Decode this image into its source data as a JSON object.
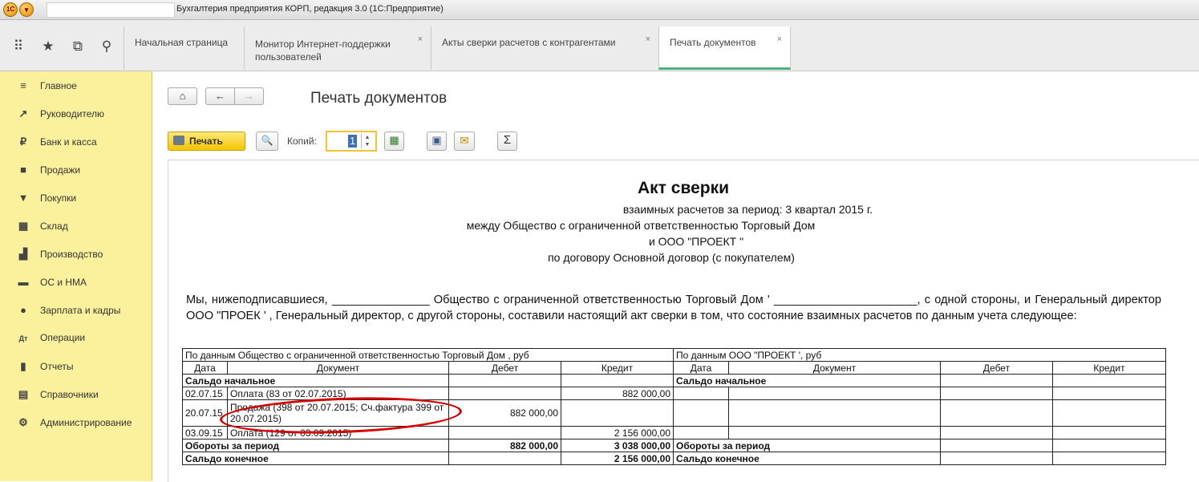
{
  "window": {
    "title": "Бухгалтерия предприятия КОРП, редакция 3.0  (1С:Предприятие)",
    "sys_icon": "1С"
  },
  "tabs": [
    {
      "label": "Начальная страница",
      "closable": false
    },
    {
      "label": "Монитор Интернет-поддержки пользователей",
      "closable": true
    },
    {
      "label": "Акты сверки расчетов с контрагентами",
      "closable": true
    },
    {
      "label": "Печать документов",
      "closable": true,
      "active": true
    }
  ],
  "close_glyph": "×",
  "sidebar": {
    "items": [
      {
        "label": "Главное",
        "icon": "≡"
      },
      {
        "label": "Руководителю",
        "icon": "↗"
      },
      {
        "label": "Банк и касса",
        "icon": "₽"
      },
      {
        "label": "Продажи",
        "icon": "■"
      },
      {
        "label": "Покупки",
        "icon": "▼"
      },
      {
        "label": "Склад",
        "icon": "▦"
      },
      {
        "label": "Производство",
        "icon": "▟"
      },
      {
        "label": "ОС и НМА",
        "icon": "▬"
      },
      {
        "label": "Зарплата и кадры",
        "icon": "●"
      },
      {
        "label": "Операции",
        "icon": "Дт"
      },
      {
        "label": "Отчеты",
        "icon": "▮"
      },
      {
        "label": "Справочники",
        "icon": "▤"
      },
      {
        "label": "Администрирование",
        "icon": "⚙"
      }
    ]
  },
  "page": {
    "title": "Печать документов",
    "print_label": "Печать",
    "copies_label": "Копий:",
    "copies_value": "1",
    "sum_glyph": "Σ"
  },
  "document": {
    "title": "Акт сверки",
    "lines": [
      "взаимных расчетов за период: 3 квартал 2015 г.",
      "между Общество с ограниченной ответственностью Торговый Дом",
      "и ООО \"ПРОЕКТ          \"",
      "по договору Основной договор (с покупателем)"
    ],
    "paragraph": "Мы, нижеподписавшиеся, _______________ Общество с ограниченной ответственностью Торговый Дом '               ______________________, с одной стороны, и Генеральный директор ООО \"ПРОЕК            '                                          , Генеральный директор, с другой стороны, составили настоящий акт сверки в том, что состояние взаимных расчетов по данным учета следующее:",
    "table": {
      "left_header": "По данным Общество с ограниченной ответственностью Торговый Дом                 , руб",
      "right_header": "По данным ООО \"ПРОЕКТ          ', руб",
      "cols": [
        "Дата",
        "Документ",
        "Дебет",
        "Кредит",
        "Дата",
        "Документ",
        "Дебет",
        "Кредит"
      ],
      "opening": "Сальдо начальное",
      "rows": [
        {
          "date": "02.07.15",
          "doc": "Оплата (83 от 02.07.2015)",
          "debit": "",
          "credit": "882 000,00"
        },
        {
          "date": "20.07.15",
          "doc": "Продажа (398 от 20.07.2015; Сч.фактура 399 от 20.07.2015)",
          "debit": "882 000,00",
          "credit": ""
        },
        {
          "date": "03.09.15",
          "doc": "Оплата (129 от 03.09.2015)",
          "debit": "",
          "credit": "2 156 000,00"
        }
      ],
      "turnover_label": "Обороты за период",
      "turnover_debit": "882 000,00",
      "turnover_credit": "3 038 000,00",
      "closing_label": "Сальдо конечное",
      "closing_credit": "2 156 000,00"
    }
  },
  "colors": {
    "sidebar": "#fbf09b",
    "accent": "#4eb185",
    "print_button": "#f5c400",
    "highlight": "#d40000"
  }
}
